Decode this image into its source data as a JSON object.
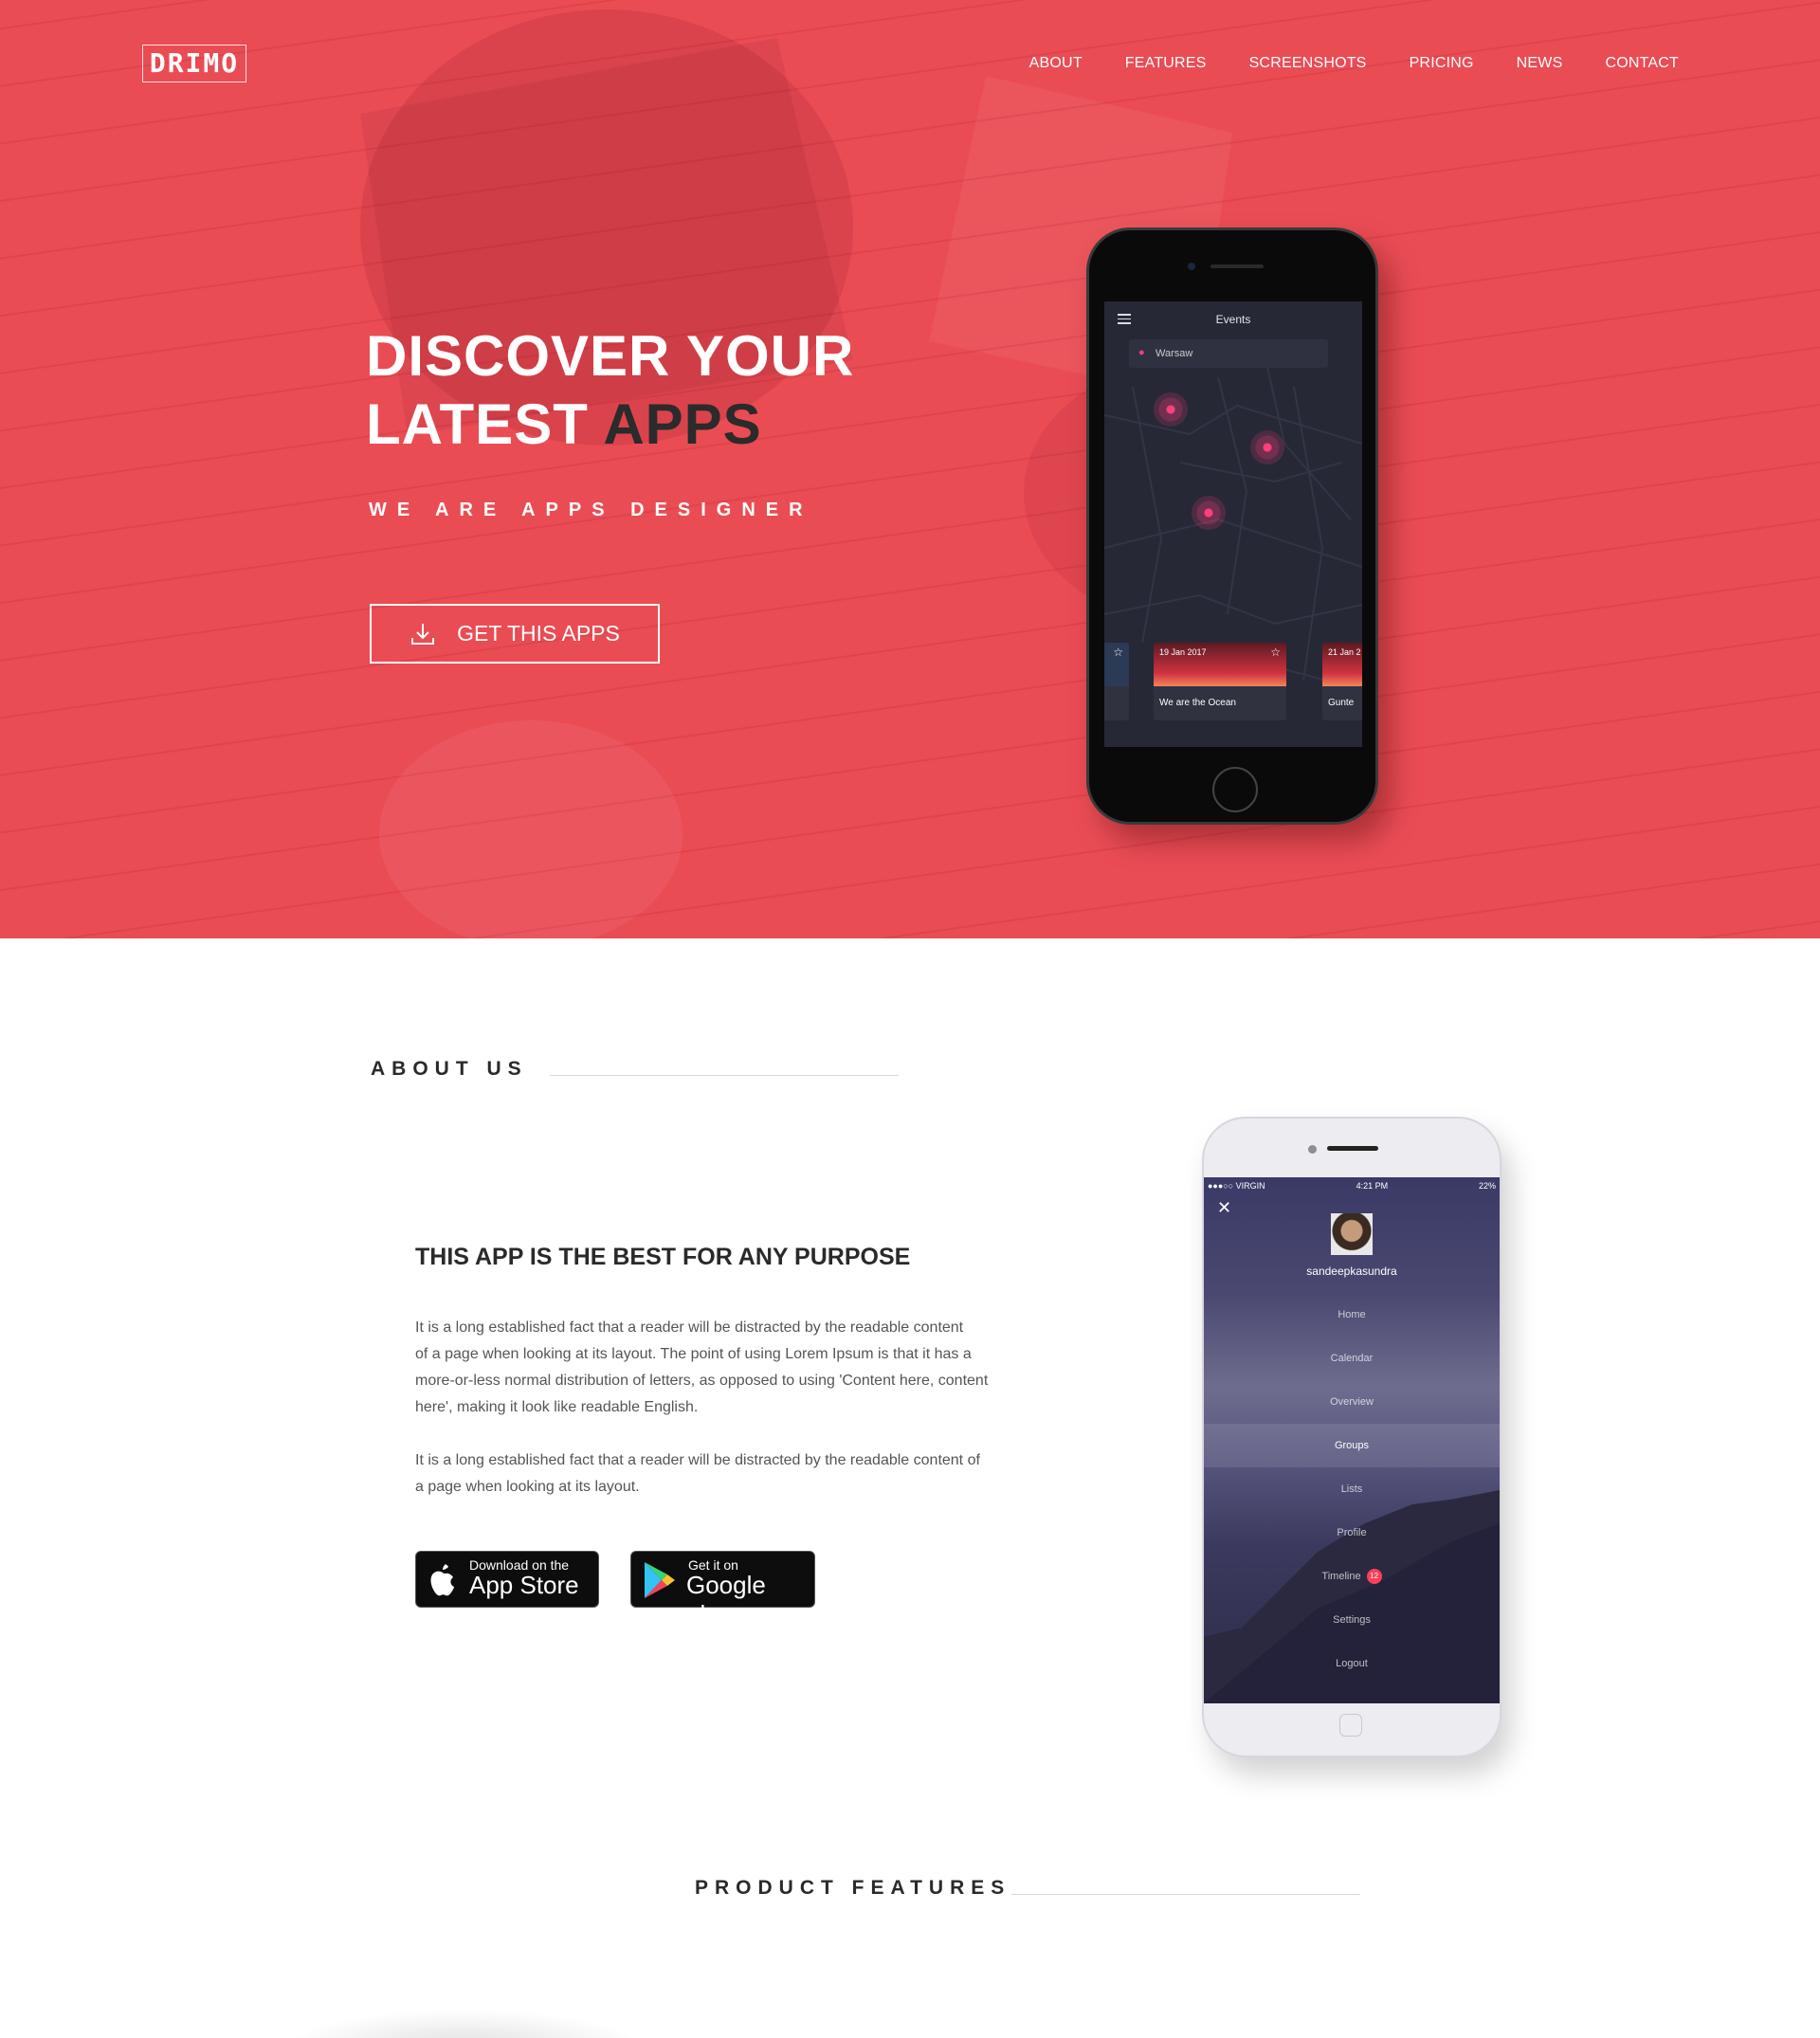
{
  "brand": {
    "logo_text": "DRIMO",
    "accent": "#ea4c54"
  },
  "nav": {
    "items": [
      "ABOUT",
      "FEATURES",
      "SCREENSHOTS",
      "PRICING",
      "NEWS",
      "CONTACT"
    ]
  },
  "hero": {
    "title_line1": "DISCOVER YOUR",
    "title_line2_light": "LATEST ",
    "title_line2_dark": "APPS",
    "subtitle": "WE ARE APPS DESIGNER",
    "cta_label": "GET THIS APPS",
    "cta_icon": "download-icon"
  },
  "events_app": {
    "title": "Events",
    "location": "Warsaw",
    "cards": [
      {
        "date": "",
        "name": ""
      },
      {
        "date": "19 Jan 2017",
        "name": "We are the Ocean"
      },
      {
        "date": "21 Jan 2",
        "name": "Gunte"
      }
    ]
  },
  "about": {
    "section_title": "ABOUT US",
    "heading": "THIS APP IS THE BEST FOR ANY PURPOSE",
    "paragraph1_lines": [
      "It is a long established fact that a reader will be distracted by the readable content",
      "of a page when looking at its layout. The point of using Lorem Ipsum is that it has a",
      "more-or-less normal distribution of letters, as opposed to using 'Content here, content",
      "here', making it look like readable English."
    ],
    "paragraph2_lines": [
      "It is a long established fact that a reader will be distracted by the readable content of",
      "a page when looking at its layout."
    ],
    "appstore": {
      "small": "Download on the",
      "big": "App Store"
    },
    "googleplay": {
      "small": "Get it on",
      "big": "Google play"
    }
  },
  "menu_app": {
    "status_left": "●●●○○ VIRGIN",
    "status_time": "4:21 PM",
    "status_right": "22%",
    "user": "sandeepkasundra",
    "items": [
      "Home",
      "Calendar",
      "Overview",
      "Groups",
      "Lists",
      "Profile",
      "Timeline",
      "Settings",
      "Logout"
    ],
    "active": "Groups",
    "timeline_badge": "12"
  },
  "features": {
    "section_title": "PRODUCT FEATURES"
  }
}
